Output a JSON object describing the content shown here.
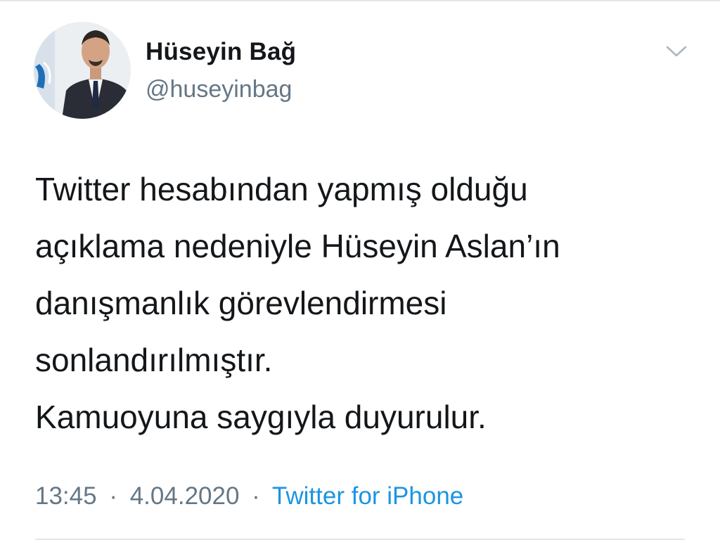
{
  "author": {
    "display_name": "Hüseyin Bağ",
    "handle": "@huseyinbag"
  },
  "icons": {
    "more_menu": "chevron-down-icon"
  },
  "tweet": {
    "lines": [
      "Twitter hesabından yapmış olduğu",
      "açıklama nedeniyle Hüseyin Aslan’ın",
      "danışmanlık görevlendirmesi",
      "sonlandırılmıştır.",
      "Kamuoyuna saygıyla duyurulur."
    ]
  },
  "meta": {
    "time": "13:45",
    "separator": "·",
    "date": "4.04.2020",
    "source": "Twitter for iPhone"
  },
  "colors": {
    "text_primary": "#14171a",
    "text_secondary": "#657786",
    "link": "#1b95e0",
    "divider": "#e3e7eb"
  }
}
